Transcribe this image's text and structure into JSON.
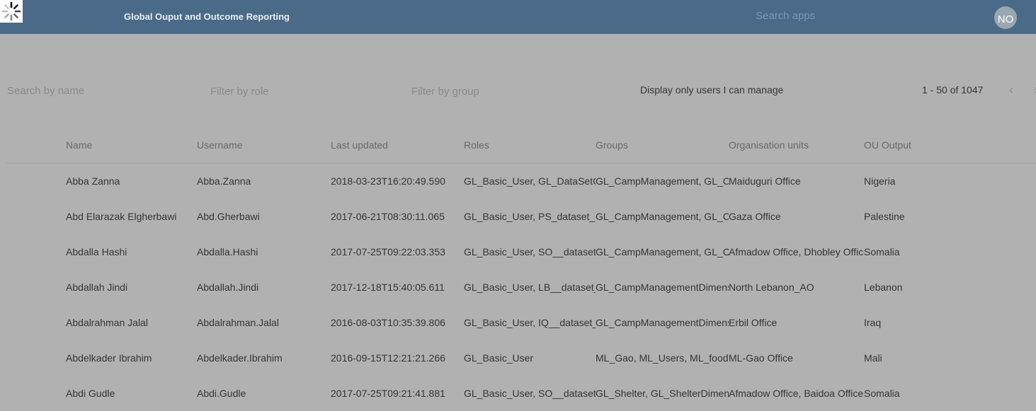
{
  "header": {
    "title": "Global Ouput and Outcome Reporting",
    "search_placeholder": "Search apps",
    "avatar_initials": "NO",
    "loading_icon": "spinner-icon",
    "background_color": "#4a6a87"
  },
  "filters": {
    "name_placeholder": "Search by name",
    "role_placeholder": "Filter by role",
    "group_placeholder": "Filter by group",
    "manage_toggle_label": "Display only users I can manage"
  },
  "pagination": {
    "range_text": "1 - 50 of 1047",
    "prev_icon": "chevron-left-icon",
    "next_icon": "chevron-right-icon"
  },
  "table": {
    "columns": [
      "Name",
      "Username",
      "Last updated",
      "Roles",
      "Groups",
      "Organisation units",
      "OU Output"
    ],
    "rows": [
      [
        "Abba Zanna",
        "Abba.Zanna",
        "2018-03-23T16:20:49.590",
        "GL_Basic_User, GL_DataSetCo",
        "GL_CampManagement, GL_Ca",
        "Maiduguri Office",
        "Nigeria"
      ],
      [
        "Abd Elarazak Elgherbawi",
        "Abd.Gherbawi",
        "2017-06-21T08:30:11.065",
        "GL_Basic_User, PS_dataset_Cl",
        "GL_CampManagement, GL_Ca",
        "Gaza Office",
        "Palestine"
      ],
      [
        "Abdalla Hashi",
        "Abdalla.Hashi",
        "2017-07-25T09:22:03.353",
        "GL_Basic_User, SO__dataset_e",
        "GL_CampManagement, GL_Ca",
        "Afmadow Office, Dhobley Office",
        "Somalia"
      ],
      [
        "Abdallah Jindi",
        "Abdallah.Jindi",
        "2017-12-18T15:40:05.611",
        "GL_Basic_User, LB__dataset_e",
        "GL_CampManagementDimens",
        "North Lebanon_AO",
        "Lebanon"
      ],
      [
        "Abdalrahman Jalal",
        "Abdalrahman.Jalal",
        "2016-08-03T10:35:39.806",
        "GL_Basic_User, IQ__dataset_c",
        "GL_CampManagementDimens",
        "Erbil Office",
        "Iraq"
      ],
      [
        "Abdelkader Ibrahim",
        "Abdelkader.Ibrahim",
        "2016-09-15T12:21:21.266",
        "GL_Basic_User",
        "ML_Gao, ML_Users, ML_foods",
        "ML-Gao Office",
        "Mali"
      ],
      [
        "Abdi Gudle",
        "Abdi.Gudle",
        "2017-07-25T09:21:41.881",
        "GL_Basic_User, SO__dataset_s",
        "GL_Shelter, GL_ShelterDimens",
        "Afmadow Office, Baidoa Office,",
        "Somalia"
      ]
    ]
  }
}
